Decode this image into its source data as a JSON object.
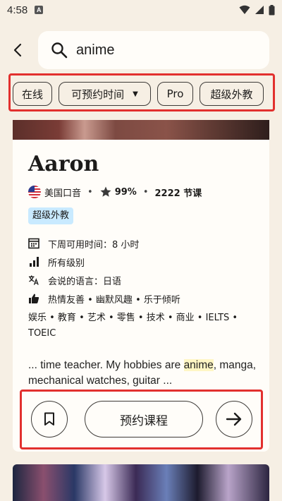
{
  "status_bar": {
    "time": "4:58",
    "notification_letter": "A"
  },
  "search": {
    "value": "anime"
  },
  "filters": [
    {
      "label": "在线"
    },
    {
      "label": "可预约时间",
      "has_dropdown": true
    },
    {
      "label": "Pro"
    },
    {
      "label": "超级外教"
    }
  ],
  "tutor": {
    "name": "Aaron",
    "accent": "美国口音",
    "rating": "99%",
    "lessons": "2222 节课",
    "badge": "超级外教",
    "availability": "下周可用时间：8 小时",
    "levels": "所有级别",
    "languages": "会说的语言：日语",
    "traits": "热情友善 • 幽默风趣 • 乐于倾听",
    "topics": "娱乐 • 教育 • 艺术 • 零售 • 技术 • 商业 • IELTS • TOEIC",
    "bio_before": "... time teacher. My hobbies are ",
    "bio_highlight": "anime",
    "bio_after": ", manga, mechanical watches, guitar ..."
  },
  "actions": {
    "book_label": "预约课程"
  },
  "colors": {
    "background": "#f6efe4",
    "card": "#fffdf9",
    "badge": "#c9eaff",
    "highlight_border": "#e2302e",
    "text_highlight": "#fff6c4"
  }
}
